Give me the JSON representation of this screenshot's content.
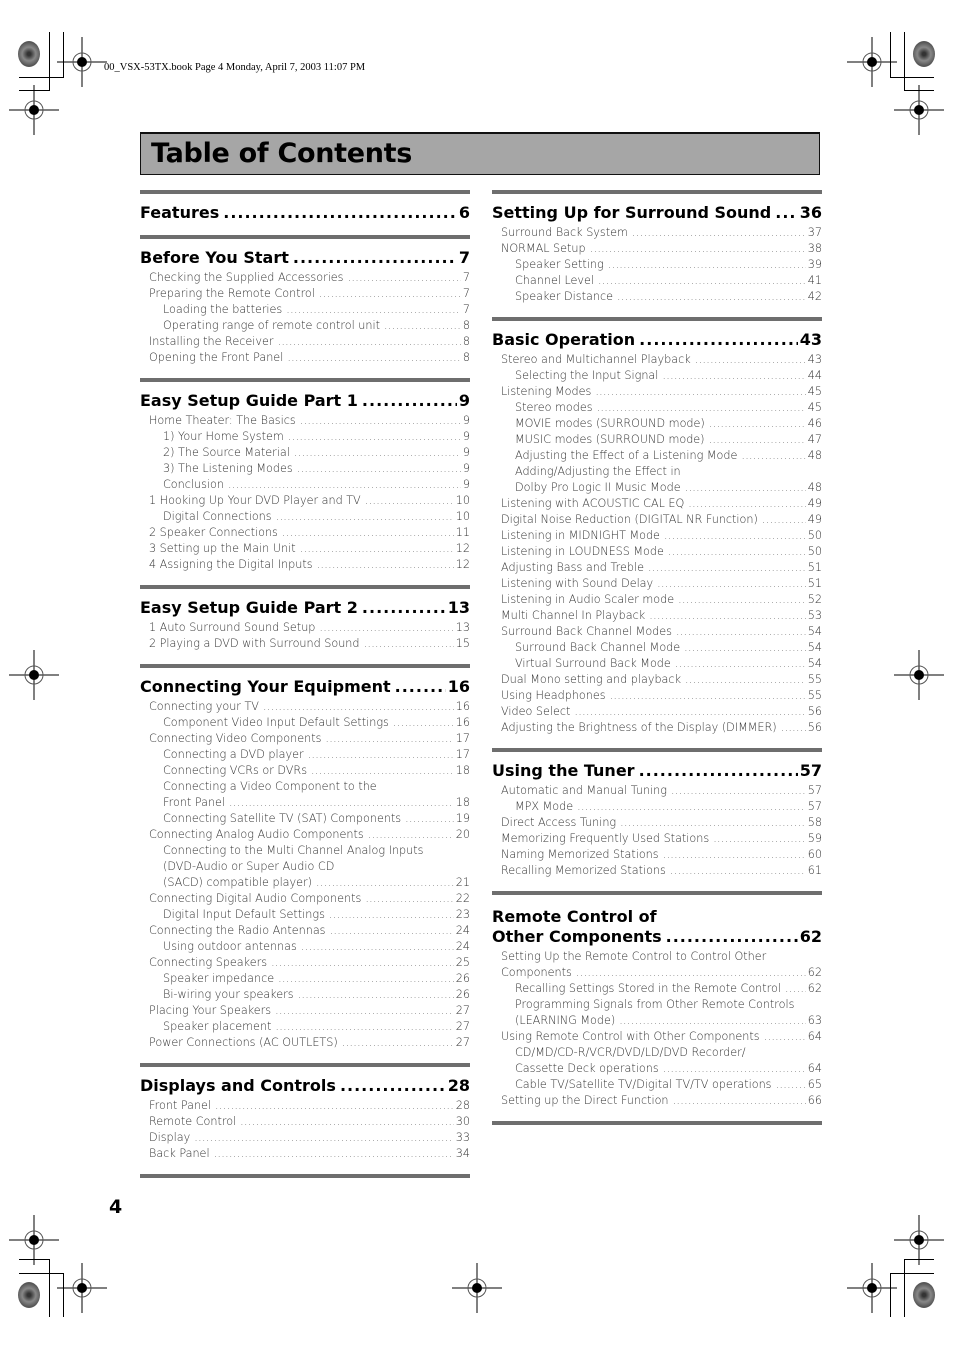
{
  "slug": "00_VSX-53TX.book  Page 4  Monday, April 7, 2003  11:07 PM",
  "title": "Table of Contents",
  "page_number": "4",
  "colors": {
    "title_bar": "#a6a6a6",
    "rule": "#6e6e6e",
    "entry_text": "#333333"
  },
  "left_column": [
    {
      "title": "Features",
      "page": "6",
      "entries": []
    },
    {
      "title": "Before You Start",
      "page": "7",
      "entries": [
        {
          "text": "Checking the Supplied Accessories",
          "page": "7",
          "level": 1
        },
        {
          "text": "Preparing the Remote Control",
          "page": "7",
          "level": 1
        },
        {
          "text": "Loading the batteries",
          "page": "7",
          "level": 2
        },
        {
          "text": "Operating range of remote control unit",
          "page": "8",
          "level": 2
        },
        {
          "text": "Installing the Receiver",
          "page": "8",
          "level": 1
        },
        {
          "text": "Opening the Front Panel",
          "page": "8",
          "level": 1
        }
      ]
    },
    {
      "title": "Easy Setup Guide Part 1",
      "page": "9",
      "entries": [
        {
          "text": "Home Theater: The Basics",
          "page": "9",
          "level": 1
        },
        {
          "text": "1) Your Home System",
          "page": "9",
          "level": 2
        },
        {
          "text": "2) The Source Material",
          "page": "9",
          "level": 2
        },
        {
          "text": "3) The Listening Modes",
          "page": "9",
          "level": 2
        },
        {
          "text": "Conclusion",
          "page": "9",
          "level": 2
        },
        {
          "text": "1 Hooking Up Your DVD Player and TV",
          "page": "10",
          "level": 1
        },
        {
          "text": "Digital Connections",
          "page": "10",
          "level": 2
        },
        {
          "text": "2 Speaker Connections",
          "page": "11",
          "level": 1
        },
        {
          "text": "3 Setting up the Main Unit",
          "page": "12",
          "level": 1
        },
        {
          "text": "4 Assigning the Digital Inputs",
          "page": "12",
          "level": 1
        }
      ]
    },
    {
      "title": "Easy Setup Guide Part 2",
      "page": "13",
      "entries": [
        {
          "text": "1 Auto Surround Sound Setup",
          "page": "13",
          "level": 1
        },
        {
          "text": "2 Playing a DVD with Surround Sound",
          "page": "15",
          "level": 1
        }
      ]
    },
    {
      "title": "Connecting Your Equipment",
      "page": "16",
      "entries": [
        {
          "text": "Connecting your TV",
          "page": "16",
          "level": 1
        },
        {
          "text": "Component Video Input Default Settings",
          "page": "16",
          "level": 2
        },
        {
          "text": "Connecting Video Components",
          "page": "17",
          "level": 1
        },
        {
          "text": "Connecting a DVD player",
          "page": "17",
          "level": 2
        },
        {
          "text": "Connecting VCRs or DVRs",
          "page": "18",
          "level": 2
        },
        {
          "text": "Connecting a Video Component to the",
          "page": "",
          "level": 2,
          "continued": true
        },
        {
          "text": "Front Panel",
          "page": "18",
          "level": 2
        },
        {
          "text": "Connecting Satellite TV (SAT) Components",
          "page": "19",
          "level": 2
        },
        {
          "text": "Connecting Analog Audio Components",
          "page": "20",
          "level": 1
        },
        {
          "text": "Connecting to the Multi Channel Analog Inputs",
          "page": "",
          "level": 2,
          "continued": true
        },
        {
          "text": "(DVD-Audio or Super Audio CD",
          "page": "",
          "level": 2,
          "continued": true
        },
        {
          "text": "(SACD) compatible player)",
          "page": "21",
          "level": 2
        },
        {
          "text": "Connecting Digital Audio Components",
          "page": "22",
          "level": 1
        },
        {
          "text": "Digital Input Default Settings",
          "page": "23",
          "level": 2
        },
        {
          "text": "Connecting the Radio Antennas",
          "page": "24",
          "level": 1
        },
        {
          "text": "Using outdoor antennas",
          "page": "24",
          "level": 2
        },
        {
          "text": "Connecting Speakers",
          "page": "25",
          "level": 1
        },
        {
          "text": "Speaker impedance",
          "page": "26",
          "level": 2
        },
        {
          "text": "Bi-wiring your speakers",
          "page": "26",
          "level": 2
        },
        {
          "text": "Placing Your Speakers",
          "page": "27",
          "level": 1
        },
        {
          "text": "Speaker placement",
          "page": "27",
          "level": 2
        },
        {
          "text": "Power Connections (AC OUTLETS)",
          "page": "27",
          "level": 1
        }
      ]
    },
    {
      "title": "Displays and Controls",
      "page": "28",
      "entries": [
        {
          "text": "Front Panel",
          "page": "28",
          "level": 1
        },
        {
          "text": "Remote Control",
          "page": "30",
          "level": 1
        },
        {
          "text": "Display",
          "page": "33",
          "level": 1
        },
        {
          "text": "Back Panel",
          "page": "34",
          "level": 1
        }
      ]
    }
  ],
  "right_column": [
    {
      "title": "Setting Up for Surround Sound",
      "page": "36",
      "entries": [
        {
          "text": "Surround Back System",
          "page": "37",
          "level": 1
        },
        {
          "text": "NORMAL Setup",
          "page": "38",
          "level": 1
        },
        {
          "text": "Speaker Setting",
          "page": "39",
          "level": 2
        },
        {
          "text": "Channel Level",
          "page": "41",
          "level": 2
        },
        {
          "text": "Speaker Distance",
          "page": "42",
          "level": 2
        }
      ]
    },
    {
      "title": "Basic Operation",
      "page": "43",
      "entries": [
        {
          "text": "Stereo and Multichannel Playback",
          "page": "43",
          "level": 1
        },
        {
          "text": "Selecting the Input Signal",
          "page": "44",
          "level": 2
        },
        {
          "text": "Listening Modes",
          "page": "45",
          "level": 1
        },
        {
          "text": "Stereo modes",
          "page": "45",
          "level": 2
        },
        {
          "text": "MOVIE modes (SURROUND mode)",
          "page": "46",
          "level": 2
        },
        {
          "text": "MUSIC modes (SURROUND mode)",
          "page": "47",
          "level": 2
        },
        {
          "text": "Adjusting the Effect of a Listening Mode",
          "page": "48",
          "level": 2
        },
        {
          "text": "Adding/Adjusting the Effect in",
          "page": "",
          "level": 2,
          "continued": true
        },
        {
          "text": "Dolby Pro Logic II Music Mode",
          "page": "48",
          "level": 2
        },
        {
          "text": "Listening with ACOUSTIC CAL EQ",
          "page": "49",
          "level": 1
        },
        {
          "text": "Digital Noise Reduction (DIGITAL NR Function)",
          "page": "49",
          "level": 1
        },
        {
          "text": "Listening in MIDNIGHT Mode",
          "page": "50",
          "level": 1
        },
        {
          "text": "Listening in LOUDNESS Mode",
          "page": "50",
          "level": 1
        },
        {
          "text": "Adjusting Bass and Treble",
          "page": "51",
          "level": 1
        },
        {
          "text": "Listening with Sound Delay",
          "page": "51",
          "level": 1
        },
        {
          "text": "Listening in Audio Scaler mode",
          "page": "52",
          "level": 1
        },
        {
          "text": "Multi Channel In Playback",
          "page": "53",
          "level": 1
        },
        {
          "text": "Surround Back Channel Modes",
          "page": "54",
          "level": 1
        },
        {
          "text": "Surround Back Channel Mode",
          "page": "54",
          "level": 2
        },
        {
          "text": "Virtual Surround Back Mode",
          "page": "54",
          "level": 2
        },
        {
          "text": "Dual Mono setting and playback",
          "page": "55",
          "level": 1
        },
        {
          "text": "Using Headphones",
          "page": "55",
          "level": 1
        },
        {
          "text": "Video Select",
          "page": "56",
          "level": 1
        },
        {
          "text": "Adjusting the Brightness of the Display (DIMMER)",
          "page": "56",
          "level": 1
        }
      ]
    },
    {
      "title": "Using the Tuner",
      "page": "57",
      "entries": [
        {
          "text": "Automatic and Manual Tuning",
          "page": "57",
          "level": 1
        },
        {
          "text": "MPX Mode",
          "page": "57",
          "level": 2
        },
        {
          "text": "Direct Access Tuning",
          "page": "58",
          "level": 1
        },
        {
          "text": "Memorizing Frequently Used Stations",
          "page": "59",
          "level": 1
        },
        {
          "text": "Naming Memorized Stations",
          "page": "60",
          "level": 1
        },
        {
          "text": "Recalling Memorized Stations",
          "page": "61",
          "level": 1
        }
      ]
    },
    {
      "title_line1": "Remote Control of",
      "title": "Other Components",
      "page": "62",
      "entries": [
        {
          "text": "Setting Up the Remote Control to Control Other",
          "page": "",
          "level": 1,
          "continued": true
        },
        {
          "text": "Components",
          "page": "62",
          "level": 1
        },
        {
          "text": "Recalling Settings Stored in the Remote Control",
          "page": "62",
          "level": 2
        },
        {
          "text": "Programming Signals from Other Remote Controls",
          "page": "",
          "level": 2,
          "continued": true
        },
        {
          "text": "(LEARNING Mode)",
          "page": "63",
          "level": 2
        },
        {
          "text": "Using Remote Control with Other Components",
          "page": "64",
          "level": 1
        },
        {
          "text": "CD/MD/CD-R/VCR/DVD/LD/DVD Recorder/",
          "page": "",
          "level": 2,
          "continued": true
        },
        {
          "text": "Cassette Deck operations",
          "page": "64",
          "level": 2
        },
        {
          "text": "Cable TV/Satellite TV/Digital TV/TV operations",
          "page": "65",
          "level": 2
        },
        {
          "text": "Setting up the Direct Function",
          "page": "66",
          "level": 1
        }
      ]
    }
  ]
}
